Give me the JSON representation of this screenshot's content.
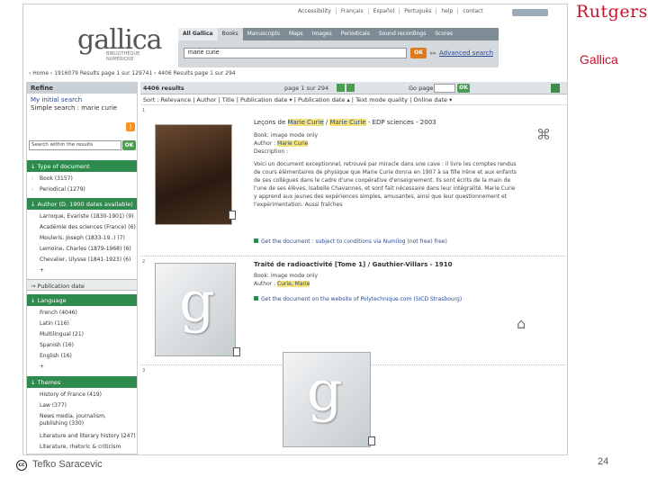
{
  "slide": {
    "brand": "Rutgers",
    "label": "Gallica",
    "author": "Tefko Saracevic",
    "page": "24"
  },
  "toplinks": [
    "Accessibility",
    "Français",
    "Español",
    "Português",
    "help",
    "contact"
  ],
  "logo": {
    "name": "gallica",
    "sub1": "BIBLIOTHÈQUE",
    "sub2": "NUMÉRIQUE"
  },
  "tabs": [
    "All Gallica",
    "Books",
    "Manuscripts",
    "Maps",
    "Images",
    "Periodicals",
    "Sound recordings",
    "Scores"
  ],
  "search": {
    "value": "marie curie",
    "ok": "OK",
    "advanced": "Advanced search"
  },
  "breadcrumb": "› Home  › 1916079 Results page 1 sur 129741  › 4406 Results page 1 sur 294",
  "left": {
    "refine": "Refine",
    "my_initial": "My initial search",
    "simple_label": "Simple search :",
    "simple_value": "marie curie",
    "within_placeholder": "Search within the results",
    "ok": "OK",
    "sections": {
      "type": "Type of document",
      "author": "Author (D. 1900 dates available)",
      "pubdate": "Publication date",
      "language": "Language",
      "themes": "Themes"
    },
    "types": [
      "Book (3157)",
      "Periodical (1279)"
    ],
    "authors": [
      "Larroque, Evariste (1830-1901) (9)",
      "Académie des sciences (France) (6)",
      "Mouleris, Joseph (1833-19..) (7)",
      "Lemoine, Charles (1879-1968) (6)",
      "Chevalier, Ulysse (1841-1923) (6)",
      "+"
    ],
    "languages": [
      "French (4046)",
      "Latin (116)",
      "Multilingual (21)",
      "Spanish (16)",
      "English (16)",
      "+"
    ],
    "themes": [
      "History of France (419)",
      "Law (377)",
      "News media, journalism, publishing (330)",
      "Literature and literary history (247)",
      "Literature, rhetoric & criticism"
    ]
  },
  "results": {
    "count": "4406 results",
    "pager": "page 1 sur 294",
    "goto": "Go page:",
    "ok": "OK",
    "sort": "Sort : Relevance | Author | Title | Publication date ▾ | Publication date ▴ | Text mode quality | Online date ▾",
    "items": [
      {
        "num": "1",
        "t1": "Leçons de ",
        "h1": "Marie Curie",
        "t2": " / ",
        "h2": "Marie Curie",
        "t3": " - EDP sciences - 2003",
        "format": "Book: image mode only",
        "author_label": "Author : ",
        "author": "Marie Curie",
        "desc_label": "Description :",
        "desc": "Voici un document exceptionnel, retrouvé par miracle dans une cave : il livre les comptes rendus de cours élémentaires de physique que Marie Curie donna en 1907 à sa fille Irène et aux enfants de ses collègues dans le cadre d'une coopérative d'enseignement. Ils sont écrits de la main de l'une de ses élèves, Isabelle Chavannes, et sont fait nécessaire dans leur intégralité. Marie Curie y apprend aux jeunes des expériences simples, amusantes, ainsi que leur questionnement et l'expérimentation. Aussi fraîches",
        "get": "Get the document : subject to conditions via Numilog (not free) free)"
      },
      {
        "num": "2",
        "t1": "Traité de radioactivité [Tome 1] / Gauthier-Villars - 1910",
        "format": "Book: image mode only",
        "author_label": "Author : ",
        "author": "Curie, Marie",
        "get": "Get the document on the website of Polytechnique.com (SICD Strasbourg)"
      },
      {
        "num": "3"
      }
    ]
  }
}
